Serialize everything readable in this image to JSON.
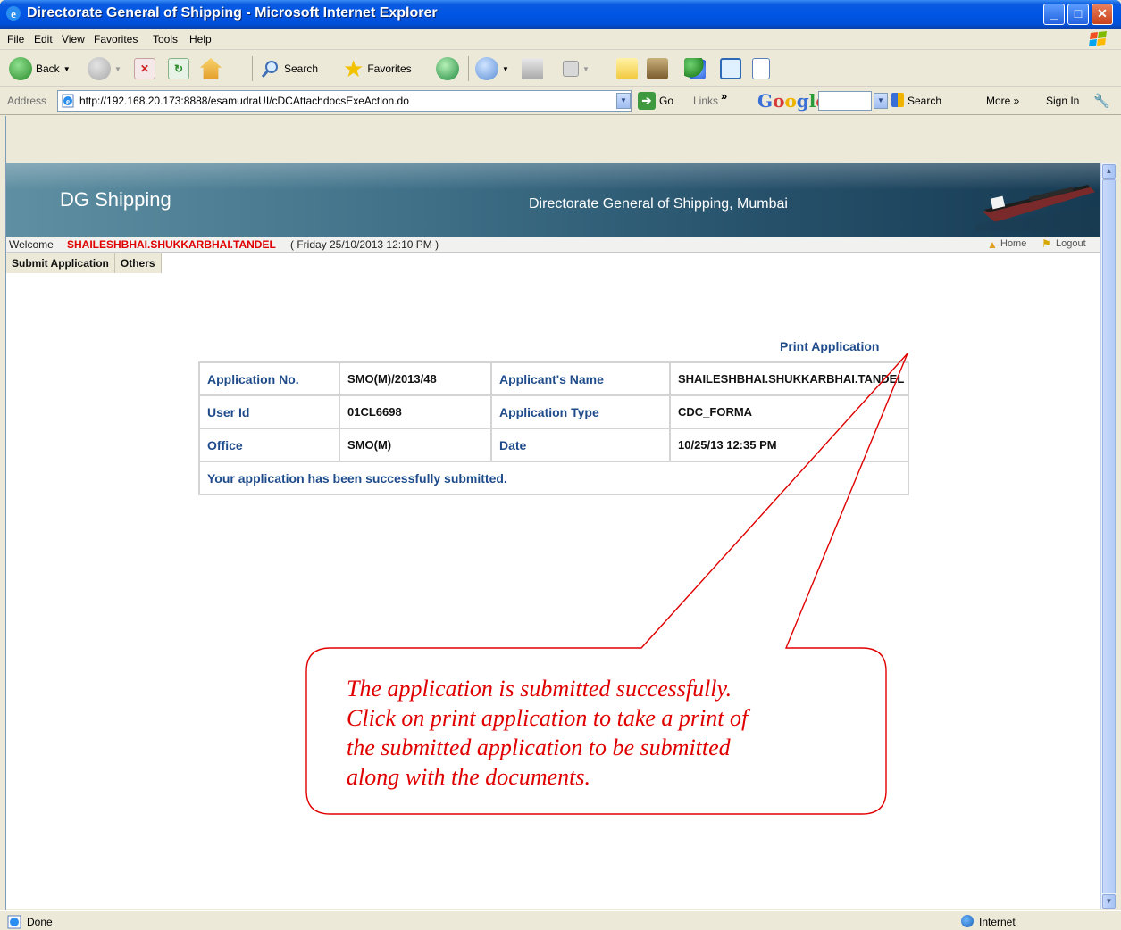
{
  "window": {
    "title": "Directorate General of Shipping - Microsoft Internet Explorer",
    "min_glyph": "_",
    "max_glyph": "□",
    "close_glyph": "✕"
  },
  "menu": [
    "File",
    "Edit",
    "View",
    "Favorites",
    "Tools",
    "Help"
  ],
  "toolbar": {
    "back_label": "Back",
    "search_label": "Search",
    "favorites_label": "Favorites"
  },
  "address": {
    "label": "Address",
    "url": "http://192.168.20.173:8888/esamudraUI/cDCAttachdocsExeAction.do",
    "go_label": "Go",
    "links_label": "Links",
    "links_chevron": "»"
  },
  "google_bar": {
    "logo": "Google",
    "search_label": "Search",
    "more_label": "More »",
    "signin_label": "Sign In"
  },
  "page": {
    "brand": "DG Shipping",
    "subtitle": "Directorate General of Shipping, Mumbai",
    "welcome_label": "Welcome",
    "user": "SHAILESHBHAI.SHUKKARBHAI.TANDEL",
    "datetime": "( Friday 25/10/2013 12:10 PM )",
    "home_label": "Home",
    "logout_label": "Logout",
    "nav": [
      "Submit Application",
      "Others"
    ],
    "print_link": "Print Application",
    "table": {
      "app_no_label": "Application No.",
      "app_no": "SMO(M)/2013/48",
      "name_label": "Applicant's Name",
      "name": "SHAILESHBHAI.SHUKKARBHAI.TANDEL",
      "userid_label": "User Id",
      "userid": "01CL6698",
      "type_label": "Application Type",
      "type": "CDC_FORMA",
      "office_label": "Office",
      "office": "SMO(M)",
      "date_label": "Date",
      "date": "10/25/13 12:35 PM",
      "message": "Your application has been successfully submitted."
    }
  },
  "callout": {
    "lines": [
      "The application is submitted successfully.",
      "Click on print application to take a print of",
      "the submitted application to be submitted",
      "along with the documents."
    ],
    "color": "#e00000"
  },
  "status": {
    "text": "Done",
    "zone": "Internet"
  }
}
